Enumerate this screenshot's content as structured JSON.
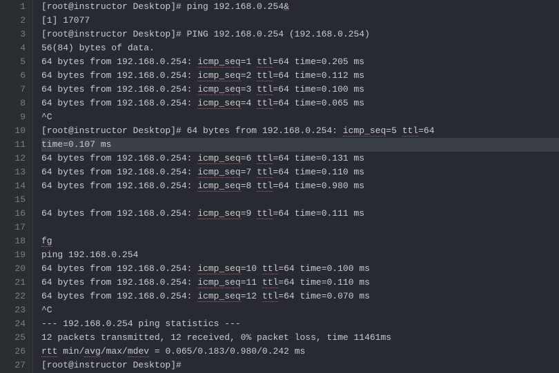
{
  "lines": [
    {
      "num": 1,
      "parts": [
        {
          "t": "[root@instructor Desktop]# ping 192.168.0.254"
        },
        {
          "t": "&",
          "cls": "amp"
        }
      ]
    },
    {
      "num": 2,
      "parts": [
        {
          "t": "[1] 17077"
        }
      ]
    },
    {
      "num": 3,
      "parts": [
        {
          "t": "[root@instructor Desktop]# PING 192.168.0.254 (192.168.0.254)"
        }
      ]
    },
    {
      "num": 4,
      "parts": [
        {
          "t": "56(84) bytes of data."
        }
      ]
    },
    {
      "num": 5,
      "parts": [
        {
          "t": "64 bytes from 192.168.0.254: "
        },
        {
          "t": "icmp_seq",
          "cls": "underline-r"
        },
        {
          "t": "=1 "
        },
        {
          "t": "ttl",
          "cls": "underline-r"
        },
        {
          "t": "=64 time=0.205 ms"
        }
      ]
    },
    {
      "num": 6,
      "parts": [
        {
          "t": "64 bytes from 192.168.0.254: "
        },
        {
          "t": "icmp_seq",
          "cls": "underline-r"
        },
        {
          "t": "=2 "
        },
        {
          "t": "ttl",
          "cls": "underline-r"
        },
        {
          "t": "=64 time=0.112 ms"
        }
      ]
    },
    {
      "num": 7,
      "parts": [
        {
          "t": "64 bytes from 192.168.0.254: "
        },
        {
          "t": "icmp_seq",
          "cls": "underline-r"
        },
        {
          "t": "=3 "
        },
        {
          "t": "ttl",
          "cls": "underline-r"
        },
        {
          "t": "=64 time=0.100 ms"
        }
      ]
    },
    {
      "num": 8,
      "parts": [
        {
          "t": "64 bytes from 192.168.0.254: "
        },
        {
          "t": "icmp_seq",
          "cls": "underline-r"
        },
        {
          "t": "=4 "
        },
        {
          "t": "ttl",
          "cls": "underline-r"
        },
        {
          "t": "=64 time=0.065 ms"
        }
      ]
    },
    {
      "num": 9,
      "parts": [
        {
          "t": "^C"
        }
      ]
    },
    {
      "num": 10,
      "parts": [
        {
          "t": "[root@instructor Desktop]# 64 bytes from 192.168.0.254: "
        },
        {
          "t": "icmp_seq",
          "cls": "underline-r"
        },
        {
          "t": "=5 "
        },
        {
          "t": "ttl",
          "cls": "underline-r"
        },
        {
          "t": "=64"
        }
      ]
    },
    {
      "num": 11,
      "highlighted": true,
      "parts": [
        {
          "t": "time=0.107 ms"
        }
      ]
    },
    {
      "num": 12,
      "parts": [
        {
          "t": "64 bytes from 192.168.0.254: "
        },
        {
          "t": "icmp_seq",
          "cls": "underline-r"
        },
        {
          "t": "=6 "
        },
        {
          "t": "ttl",
          "cls": "underline-r"
        },
        {
          "t": "=64 time=0.131 ms"
        }
      ]
    },
    {
      "num": 13,
      "parts": [
        {
          "t": "64 bytes from 192.168.0.254: "
        },
        {
          "t": "icmp_seq",
          "cls": "underline-r"
        },
        {
          "t": "=7 "
        },
        {
          "t": "ttl",
          "cls": "underline-r"
        },
        {
          "t": "=64 time=0.110 ms"
        }
      ]
    },
    {
      "num": 14,
      "parts": [
        {
          "t": "64 bytes from 192.168.0.254: "
        },
        {
          "t": "icmp_seq",
          "cls": "underline-r"
        },
        {
          "t": "=8 "
        },
        {
          "t": "ttl",
          "cls": "underline-r"
        },
        {
          "t": "=64 time=0.980 ms"
        }
      ]
    },
    {
      "num": 15,
      "parts": [
        {
          "t": ""
        }
      ]
    },
    {
      "num": 16,
      "parts": [
        {
          "t": "64 bytes from 192.168.0.254: "
        },
        {
          "t": "icmp_seq",
          "cls": "underline-r"
        },
        {
          "t": "=9 "
        },
        {
          "t": "ttl",
          "cls": "underline-r"
        },
        {
          "t": "=64 time=0.111 ms"
        }
      ]
    },
    {
      "num": 17,
      "parts": [
        {
          "t": ""
        }
      ]
    },
    {
      "num": 18,
      "parts": [
        {
          "t": "fg",
          "cls": "underline-r"
        }
      ]
    },
    {
      "num": 19,
      "parts": [
        {
          "t": "ping 192.168.0.254"
        }
      ]
    },
    {
      "num": 20,
      "parts": [
        {
          "t": "64 bytes from 192.168.0.254: "
        },
        {
          "t": "icmp_seq",
          "cls": "underline-r"
        },
        {
          "t": "=10 "
        },
        {
          "t": "ttl",
          "cls": "underline-r"
        },
        {
          "t": "=64 time=0.100 ms"
        }
      ]
    },
    {
      "num": 21,
      "parts": [
        {
          "t": "64 bytes from 192.168.0.254: "
        },
        {
          "t": "icmp_seq",
          "cls": "underline-r"
        },
        {
          "t": "=11 "
        },
        {
          "t": "ttl",
          "cls": "underline-r"
        },
        {
          "t": "=64 time=0.110 ms"
        }
      ]
    },
    {
      "num": 22,
      "parts": [
        {
          "t": "64 bytes from 192.168.0.254: "
        },
        {
          "t": "icmp_seq",
          "cls": "underline-r"
        },
        {
          "t": "=12 "
        },
        {
          "t": "ttl",
          "cls": "underline-r"
        },
        {
          "t": "=64 time=0.070 ms"
        }
      ]
    },
    {
      "num": 23,
      "parts": [
        {
          "t": "^C"
        }
      ]
    },
    {
      "num": 24,
      "parts": [
        {
          "t": "--- 192.168.0.254 ping statistics ---"
        }
      ]
    },
    {
      "num": 25,
      "parts": [
        {
          "t": "12 packets transmitted, 12 received, 0% packet loss, time 11461ms"
        }
      ]
    },
    {
      "num": 26,
      "parts": [
        {
          "t": "rtt",
          "cls": "underline-r"
        },
        {
          "t": " min/"
        },
        {
          "t": "avg",
          "cls": "underline-r"
        },
        {
          "t": "/max/"
        },
        {
          "t": "mdev",
          "cls": "underline-r"
        },
        {
          "t": " = 0.065/0.183/0.980/0.242 ms"
        }
      ]
    },
    {
      "num": 27,
      "parts": [
        {
          "t": "[root@instructor Desktop]#"
        }
      ]
    }
  ]
}
